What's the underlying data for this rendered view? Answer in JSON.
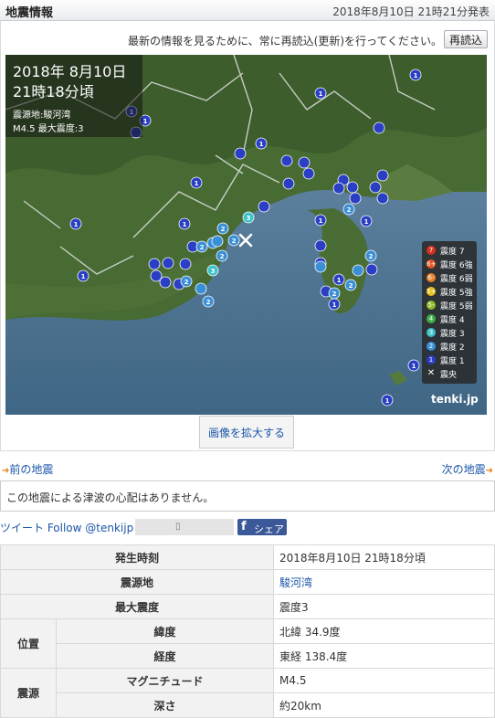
{
  "header": {
    "title": "地震情報",
    "published": "2018年8月10日 21時21分発表"
  },
  "notice": {
    "text": "最新の情報を見るために、常に再読込(更新)を行ってください。",
    "reload_label": "再読込"
  },
  "map": {
    "date": "2018年  8月10日",
    "time": "21時18分頃",
    "epicenter_line": "震源地:駿河湾",
    "magnitude_line": "M4.5    最大震度:3",
    "brand": "tenki.jp",
    "legend": [
      {
        "label": "震度 7",
        "mark": "7",
        "color": "#d8321f"
      },
      {
        "label": "震度 6強",
        "mark": "6+",
        "color": "#e0561f"
      },
      {
        "label": "震度 6弱",
        "mark": "6-",
        "color": "#e7822a"
      },
      {
        "label": "震度 5強",
        "mark": "5+",
        "color": "#e6c11e"
      },
      {
        "label": "震度 5弱",
        "mark": "5-",
        "color": "#8fbd2a"
      },
      {
        "label": "震度 4",
        "mark": "4",
        "color": "#3fae48"
      },
      {
        "label": "震度 3",
        "mark": "3",
        "color": "#3ec2c9"
      },
      {
        "label": "震度 2",
        "mark": "2",
        "color": "#3a8fd6"
      },
      {
        "label": "震度 1",
        "mark": "1",
        "color": "#2a3fc4"
      },
      {
        "label": "震央",
        "mark": "✕",
        "color": "transparent"
      }
    ],
    "station_marks": {
      "one": "1",
      "two": "2",
      "three": "3"
    },
    "enlarge_label": "画像を拡大する"
  },
  "nav": {
    "prev": "前の地震",
    "next": "次の地震"
  },
  "tsunami": "この地震による津波の心配はありません。",
  "social": {
    "tweet": "ツイート Follow @tenkijp",
    "share": "シェア"
  },
  "details": {
    "time_label": "発生時刻",
    "time_value": "2018年8月10日 21時18分頃",
    "epicenter_label": "震源地",
    "epicenter_value": "駿河湾",
    "max_label": "最大震度",
    "max_value": "震度3",
    "position_label": "位置",
    "lat_label": "緯度",
    "lat_value": "北緯 34.9度",
    "lon_label": "経度",
    "lon_value": "東経 138.4度",
    "source_label": "震源",
    "mag_label": "マグニチュード",
    "mag_value": "M4.5",
    "depth_label": "深さ",
    "depth_value": "約20km"
  }
}
